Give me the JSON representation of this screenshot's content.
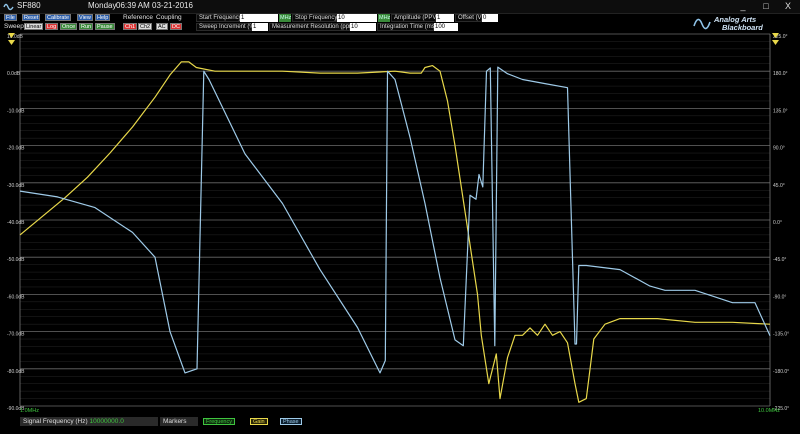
{
  "window": {
    "title": "SF880",
    "day": "Monday",
    "time": "06:39 AM",
    "date": "03-21-2016",
    "minimize": "_",
    "maximize": "□",
    "close": "X"
  },
  "toolbar": {
    "row1_buttons": [
      "File",
      "Reset",
      "Calibrate",
      "View",
      "Help"
    ],
    "reference_label": "Reference",
    "coupling_label": "Coupling",
    "row2_sweep_label": "Sweep",
    "sweep_buttons": [
      "Linear",
      "Log",
      "Once",
      "Run",
      "Pause"
    ],
    "reference_buttons": [
      "Ch1",
      "Ch2"
    ],
    "coupling_buttons": [
      "AC",
      "DC"
    ]
  },
  "params": {
    "start_frequency_label": "Start Frequency",
    "start_frequency_value": "1",
    "start_unit": "MHz",
    "stop_frequency_label": "Stop Frequency",
    "stop_frequency_value": "10",
    "stop_unit": "MHz",
    "amplitude_label": "Amplitude (PPV)",
    "amplitude_value": "1",
    "offset_label": "Offset (V)",
    "offset_value": "0",
    "sweep_increment_label": "Sweep Increment (%)",
    "sweep_increment_value": "1",
    "measurement_resolution_label": "Measurement Resolution (ppm)",
    "measurement_resolution_value": "10",
    "integration_time_label": "Integration Time (ms)",
    "integration_time_value": "100"
  },
  "logo": {
    "line1": "Analog Arts",
    "line2": "Blackboard"
  },
  "chart_data": {
    "type": "line",
    "left_axis": {
      "label_unit": "dB",
      "ticks": [
        "10.0dB",
        "0.0dB",
        "-10.0dB",
        "-20.0dB",
        "-30.0dB",
        "-40.0dB",
        "-50.0dB",
        "-60.0dB",
        "-70.0dB",
        "-80.0dB",
        "-90.0dB"
      ],
      "range": [
        -90,
        10
      ]
    },
    "right_axis": {
      "ticks": [
        "225.0°",
        "180.0°",
        "135.0°",
        "90.0°",
        "45.0°",
        "0.0°",
        "-45.0°",
        "-90.0°",
        "-135.0°",
        "-180.0°",
        "-225.0°"
      ],
      "range": [
        -225,
        225
      ]
    },
    "x_start_label": "1.0MHz",
    "x_end_label": "10.0MHz",
    "grid": true,
    "series": [
      {
        "name": "Gain",
        "color": "#e8d84a",
        "axis": "left",
        "x": [
          0.0,
          0.03,
          0.06,
          0.09,
          0.12,
          0.15,
          0.18,
          0.2,
          0.215,
          0.225,
          0.235,
          0.26,
          0.3,
          0.35,
          0.4,
          0.45,
          0.5,
          0.52,
          0.535,
          0.54,
          0.55,
          0.56,
          0.57,
          0.58,
          0.595,
          0.61,
          0.615,
          0.625,
          0.635,
          0.64,
          0.65,
          0.66,
          0.67,
          0.68,
          0.69,
          0.7,
          0.71,
          0.72,
          0.73,
          0.74,
          0.745,
          0.755,
          0.765,
          0.78,
          0.8,
          0.85,
          0.9,
          0.95,
          1.0
        ],
        "y": [
          -44,
          -39,
          -34,
          -28.5,
          -22,
          -15,
          -7,
          -1,
          2.5,
          2.5,
          1,
          0,
          0,
          0,
          -0.5,
          -0.5,
          0,
          -0.5,
          -0.5,
          1,
          1.5,
          0,
          -8,
          -20,
          -40,
          -60,
          -71,
          -84,
          -76,
          -88,
          -77,
          -71,
          -71,
          -69,
          -71,
          -68,
          -71,
          -70,
          -73,
          -84,
          -89,
          -88,
          -72,
          -68,
          -66.5,
          -66.5,
          -67.5,
          -67.5,
          -68
        ]
      },
      {
        "name": "Phase",
        "color": "#9ecae8",
        "axis": "right",
        "x": [
          0.0,
          0.05,
          0.1,
          0.15,
          0.18,
          0.2,
          0.22,
          0.236,
          0.245,
          0.252,
          0.3,
          0.35,
          0.4,
          0.45,
          0.48,
          0.487,
          0.49,
          0.5,
          0.52,
          0.54,
          0.56,
          0.58,
          0.591,
          0.6,
          0.608,
          0.612,
          0.617,
          0.622,
          0.627,
          0.633,
          0.637,
          0.645,
          0.65,
          0.67,
          0.7,
          0.73,
          0.74,
          0.742,
          0.745,
          0.755,
          0.8,
          0.84,
          0.86,
          0.9,
          0.95,
          0.98,
          1.0
        ],
        "y": [
          35,
          28,
          15,
          -15,
          -45,
          -135,
          -185,
          -180,
          180,
          170,
          80,
          20,
          -60,
          -130,
          -185,
          -170,
          180,
          170,
          100,
          20,
          -70,
          -145,
          -152,
          30,
          25,
          55,
          40,
          180,
          184,
          -152,
          185,
          180,
          177,
          170,
          165,
          160,
          -150,
          -150,
          -55,
          -55,
          -60,
          -80,
          -85,
          -85,
          -100,
          -100,
          -140
        ]
      }
    ]
  },
  "statusbar": {
    "signal_label": "Signal Frequency (Hz)",
    "signal_value": "10000000.0",
    "markers_label": "Markers",
    "marker_buttons": [
      "Frequency",
      "Gain",
      "Phase"
    ]
  }
}
